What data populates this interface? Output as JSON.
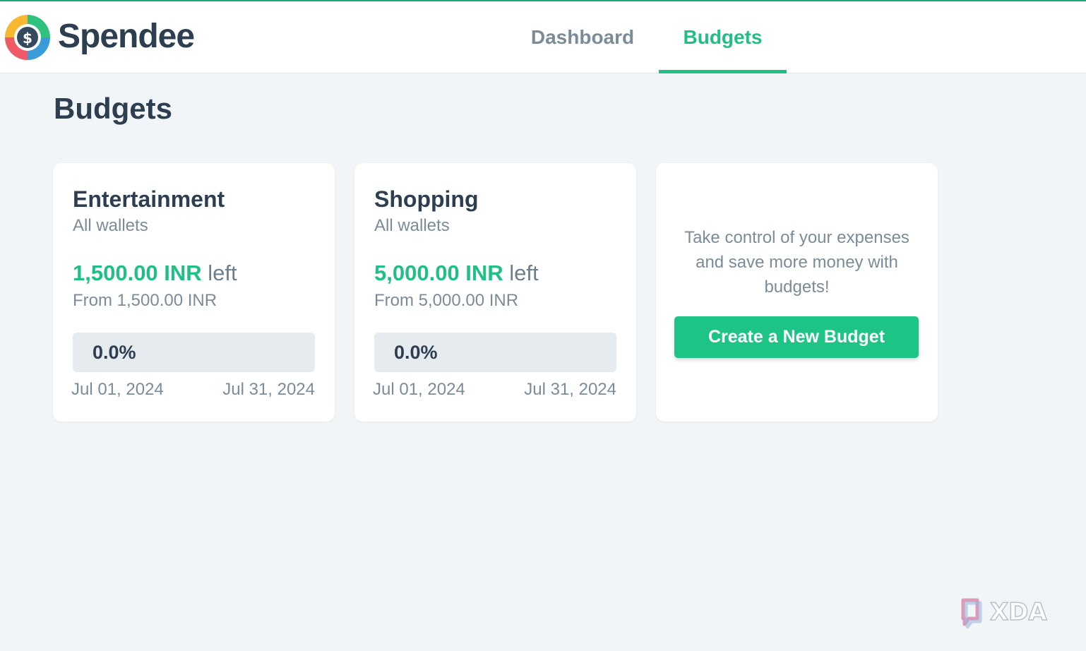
{
  "app": {
    "name": "Spendee",
    "logo_icon": "dollar-coin-icon"
  },
  "colors": {
    "accent": "#20bf86",
    "text_dark": "#2c3e50",
    "text_muted": "#7b8c99",
    "background": "#f2f5f8"
  },
  "nav": {
    "tabs": [
      {
        "label": "Dashboard",
        "active": false
      },
      {
        "label": "Budgets",
        "active": true
      }
    ]
  },
  "page": {
    "title": "Budgets"
  },
  "budgets": [
    {
      "name": "Entertainment",
      "wallets": "All wallets",
      "remaining": "1,500.00 INR",
      "left_label": "left",
      "from": "From 1,500.00 INR",
      "progress_percent": 0.0,
      "progress_label": "0.0%",
      "start_date": "Jul 01, 2024",
      "end_date": "Jul 31, 2024"
    },
    {
      "name": "Shopping",
      "wallets": "All wallets",
      "remaining": "5,000.00 INR",
      "left_label": "left",
      "from": "From 5,000.00 INR",
      "progress_percent": 0.0,
      "progress_label": "0.0%",
      "start_date": "Jul 01, 2024",
      "end_date": "Jul 31, 2024"
    }
  ],
  "promo": {
    "text": "Take control of your expenses and save more money with budgets!",
    "button_label": "Create a New Budget"
  },
  "watermark": {
    "text": "XDA",
    "icon": "xda-logo-icon"
  }
}
